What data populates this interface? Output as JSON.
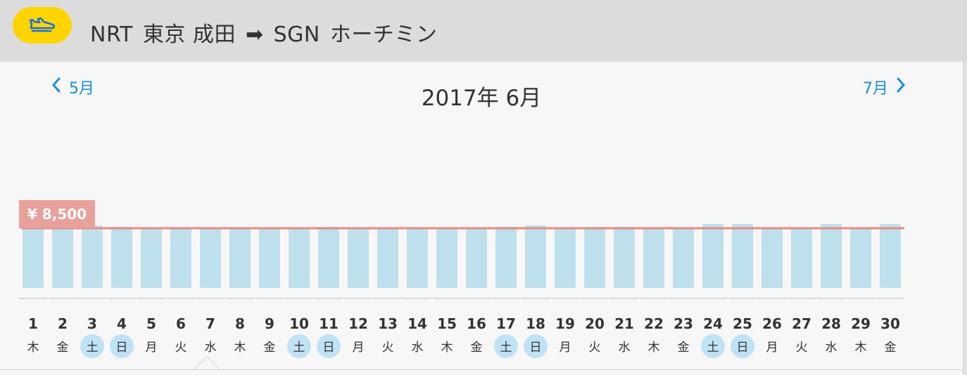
{
  "header": {
    "origin_code": "NRT",
    "origin_name": "東京 成田",
    "arrow": "➡",
    "dest_code": "SGN",
    "dest_name": "ホーチミン",
    "badge_icon": "plane-icon",
    "badge_color": "#ffd400"
  },
  "calendar": {
    "prev_label": "5月",
    "next_label": "7月",
    "title": "2017年 6月"
  },
  "price_marker": {
    "label": "¥ 8,500",
    "value": 8500,
    "color": "#e8a19a"
  },
  "colors": {
    "bar": "#bde0ec",
    "line": "#e88a80",
    "weekend_circle": "#bfe3f5"
  },
  "chart_data": {
    "type": "bar",
    "title": "",
    "xlabel": "",
    "ylabel": "",
    "categories": [
      "1",
      "2",
      "3",
      "4",
      "5",
      "6",
      "7",
      "8",
      "9",
      "10",
      "11",
      "12",
      "13",
      "14",
      "15",
      "16",
      "17",
      "18",
      "19",
      "20",
      "21",
      "22",
      "23",
      "24",
      "25",
      "26",
      "27",
      "28",
      "29",
      "30"
    ],
    "weekdays": [
      "木",
      "金",
      "土",
      "日",
      "月",
      "火",
      "水",
      "木",
      "金",
      "土",
      "日",
      "月",
      "火",
      "水",
      "木",
      "金",
      "土",
      "日",
      "月",
      "火",
      "水",
      "木",
      "金",
      "土",
      "日",
      "月",
      "火",
      "水",
      "木",
      "金"
    ],
    "weekend_flags": [
      false,
      false,
      true,
      true,
      false,
      false,
      false,
      false,
      false,
      true,
      true,
      false,
      false,
      false,
      false,
      false,
      true,
      true,
      false,
      false,
      false,
      false,
      false,
      true,
      true,
      false,
      false,
      false,
      false,
      false
    ],
    "values": [
      8500,
      8500,
      8900,
      8700,
      8500,
      8500,
      8500,
      8500,
      8500,
      8500,
      8700,
      8500,
      8500,
      8500,
      8500,
      8500,
      8700,
      8900,
      8500,
      8700,
      8700,
      8500,
      8600,
      9100,
      9100,
      8600,
      8600,
      9100,
      8600,
      9100
    ],
    "reference_line": 8500,
    "ylim": [
      0,
      8500
    ],
    "grid": false
  }
}
